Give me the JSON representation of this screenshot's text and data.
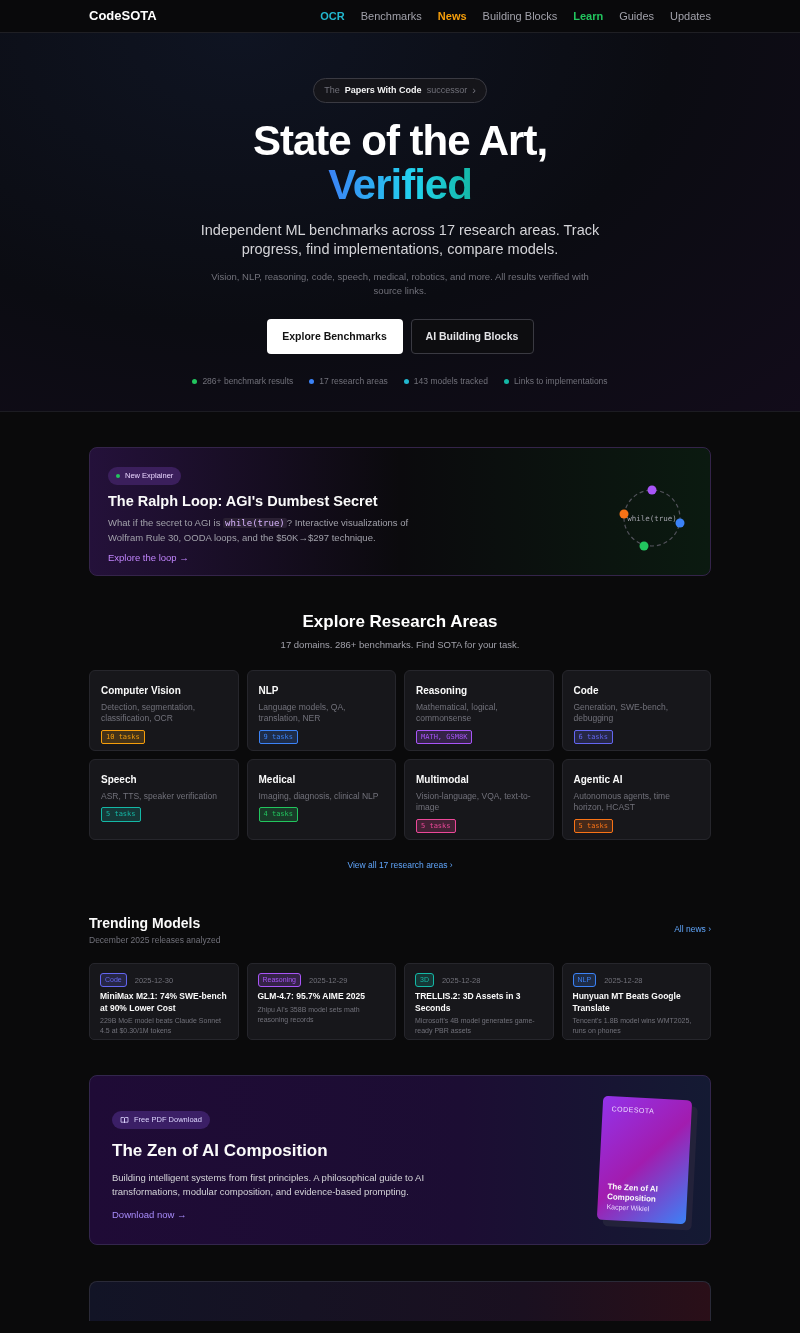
{
  "navbar": {
    "brand": "CodeSOTA",
    "links": [
      {
        "label": "OCR",
        "color": "#22b8cf"
      },
      {
        "label": "Benchmarks",
        "color": "#a1a1aa"
      },
      {
        "label": "News",
        "color": "#f59e0b"
      },
      {
        "label": "Building Blocks",
        "color": "#a1a1aa"
      },
      {
        "label": "Learn",
        "color": "#22c55e"
      },
      {
        "label": "Guides",
        "color": "#a1a1aa"
      },
      {
        "label": "Updates",
        "color": "#a1a1aa"
      }
    ]
  },
  "hero": {
    "pill": {
      "prefix": "The",
      "highlight": "Papers With Code",
      "suffix": "successor",
      "arrow": "›"
    },
    "title_line1": "State of the Art,",
    "title_line2": "Verified",
    "subtitle": "Independent ML benchmarks across 17 research areas. Track progress, find implementations, compare models.",
    "note": "Vision, NLP, reasoning, code, speech, medical, robotics, and more. All results verified with source links.",
    "buttons": [
      {
        "label": "Explore Benchmarks",
        "kind": "primary"
      },
      {
        "label": "AI Building Blocks",
        "kind": "outline"
      }
    ],
    "stats": [
      {
        "label": "286+ benchmark results",
        "color": "#22c55e"
      },
      {
        "label": "17 research areas",
        "color": "#3b82f6"
      },
      {
        "label": "143 models tracked",
        "color": "#22b8cf"
      },
      {
        "label": "Links to implementations",
        "color": "#14b8a6"
      }
    ]
  },
  "explainer": {
    "badge": "New Explainer",
    "title": "The Ralph Loop: AGI's Dumbest Secret",
    "description": {
      "before": "What if the secret to AGI is ",
      "code": "while(true)",
      "after": "? Interactive visualizations of Wolfram Rule 30, OODA loops, and the $50K→$297 technique."
    },
    "link": "Explore the loop",
    "link_arrow": "→",
    "diagram_label": "while(true)"
  },
  "research": {
    "title": "Explore Research Areas",
    "subtitle": "17 domains. 286+ benchmarks. Find SOTA for your task.",
    "areas": [
      {
        "name": "Computer Vision",
        "description": "Detection, segmentation, classification, OCR",
        "tag": "10 tasks",
        "color": "#f59e0b"
      },
      {
        "name": "NLP",
        "description": "Language models, QA, translation, NER",
        "tag": "9 tasks",
        "color": "#3b82f6"
      },
      {
        "name": "Reasoning",
        "description": "Mathematical, logical, commonsense",
        "tag": "MATH, GSM8K",
        "color": "#a855f7"
      },
      {
        "name": "Code",
        "description": "Generation, SWE-bench, debugging",
        "tag": "6 tasks",
        "color": "#6366f1"
      },
      {
        "name": "Speech",
        "description": "ASR, TTS, speaker verification",
        "tag": "5 tasks",
        "color": "#14b8a6"
      },
      {
        "name": "Medical",
        "description": "Imaging, diagnosis, clinical NLP",
        "tag": "4 tasks",
        "color": "#22c55e"
      },
      {
        "name": "Multimodal",
        "description": "Vision-language, VQA, text-to-image",
        "tag": "5 tasks",
        "color": "#ec4899"
      },
      {
        "name": "Agentic AI",
        "description": "Autonomous agents, time horizon, HCAST",
        "tag": "5 tasks",
        "color": "#f97316"
      }
    ],
    "view_all": "View all 17 research areas",
    "view_all_arrow": "›"
  },
  "trending": {
    "title": "Trending Models",
    "subtitle": "December 2025 releases analyzed",
    "all_link": "All news",
    "all_arrow": "›",
    "items": [
      {
        "tag": "Code",
        "color": "#6366f1",
        "date": "2025-12-30",
        "title": "MiniMax M2.1: 74% SWE-bench at 90% Lower Cost",
        "summary": "229B MoE model beats Claude Sonnet 4.5 at $0.30/1M tokens"
      },
      {
        "tag": "Reasoning",
        "color": "#a855f7",
        "date": "2025-12-29",
        "title": "GLM-4.7: 95.7% AIME 2025",
        "summary": "Zhipu AI's 358B model sets math reasoning records"
      },
      {
        "tag": "3D",
        "color": "#14b8a6",
        "date": "2025-12-28",
        "title": "TRELLIS.2: 3D Assets in 3 Seconds",
        "summary": "Microsoft's 4B model generates game-ready PBR assets"
      },
      {
        "tag": "NLP",
        "color": "#3b82f6",
        "date": "2025-12-28",
        "title": "Hunyuan MT Beats Google Translate",
        "summary": "Tencent's 1.8B model wins WMT2025, runs on phones"
      }
    ]
  },
  "book": {
    "badge": "Free PDF Download",
    "title": "The Zen of AI Composition",
    "description": "Building intelligent systems from first principles. A philosophical guide to AI transformations, modular composition, and evidence-based prompting.",
    "link": "Download now",
    "link_arrow": "→",
    "cover": {
      "brand": "CODESOTA",
      "title": "The Zen of AI Composition",
      "author": "Kacper Wikiel"
    }
  }
}
